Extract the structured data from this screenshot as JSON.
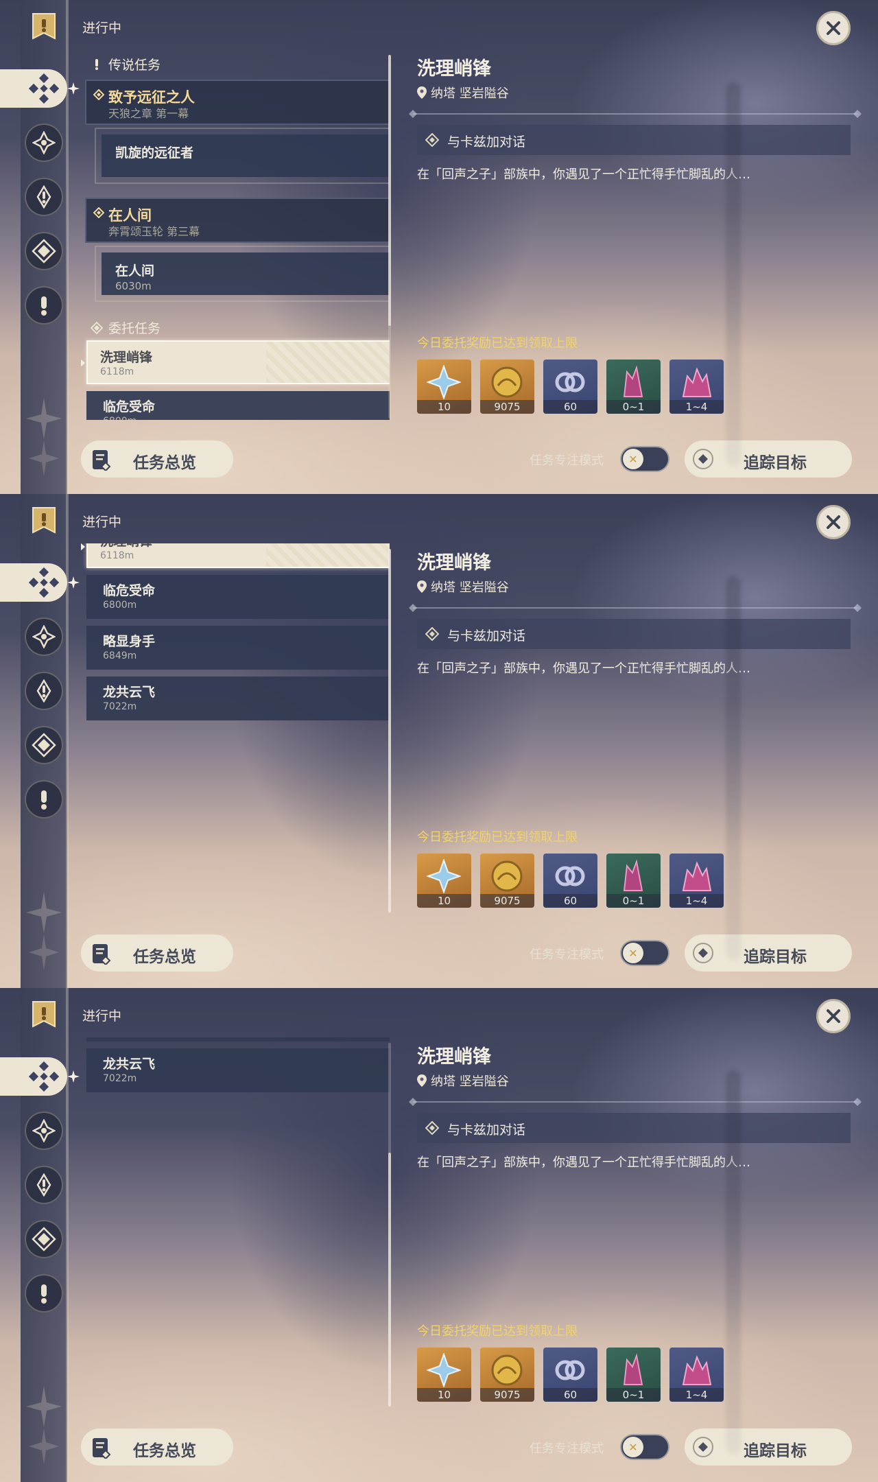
{
  "header": {
    "ongoing": "进行中"
  },
  "sections": {
    "legend": "传说任务",
    "commission": "委托任务"
  },
  "legend_groups": [
    {
      "title": "致予远征之人",
      "subtitle": "天狼之章 第一幕",
      "sub_title": "凯旋的远征者",
      "sub_dist": ""
    },
    {
      "title": "在人间",
      "subtitle": "奔霄颂玉轮 第三幕",
      "sub_title": "在人间",
      "sub_dist": "6030m"
    }
  ],
  "commissions": [
    {
      "title": "洗理峭锋",
      "dist": "6118m"
    },
    {
      "title": "临危受命",
      "dist": "6800m"
    },
    {
      "title": "略显身手",
      "dist": "6849m"
    },
    {
      "title": "龙共云飞",
      "dist": "7022m"
    }
  ],
  "detail": {
    "title": "洗理峭锋",
    "location": "纳塔 坚岩隘谷",
    "objective": "与卡兹加对话",
    "description": "在「回声之子」部族中，你遇见了一个正忙得手忙脚乱的人…",
    "reward_note": "今日委托奖励已达到领取上限",
    "rewards": [
      {
        "icon": "primogem-icon",
        "qty": "10"
      },
      {
        "icon": "mora-icon",
        "qty": "9075"
      },
      {
        "icon": "companionship-exp-icon",
        "qty": "60"
      },
      {
        "icon": "crystal-ore-icon",
        "qty": "0~1"
      },
      {
        "icon": "crystal-cluster-icon",
        "qty": "1~4"
      }
    ]
  },
  "footer": {
    "overview": "任务总览",
    "focus_mode": "任务专注模式",
    "track": "追踪目标"
  },
  "panels": [
    {
      "scroll": "top"
    },
    {
      "scroll": "middle"
    },
    {
      "scroll": "bottom"
    }
  ],
  "colors": {
    "accent_gold": "#f3d99a",
    "reward_note": "#f1d36a",
    "cream": "#ece5d3",
    "panel_navy": "#303a52"
  }
}
